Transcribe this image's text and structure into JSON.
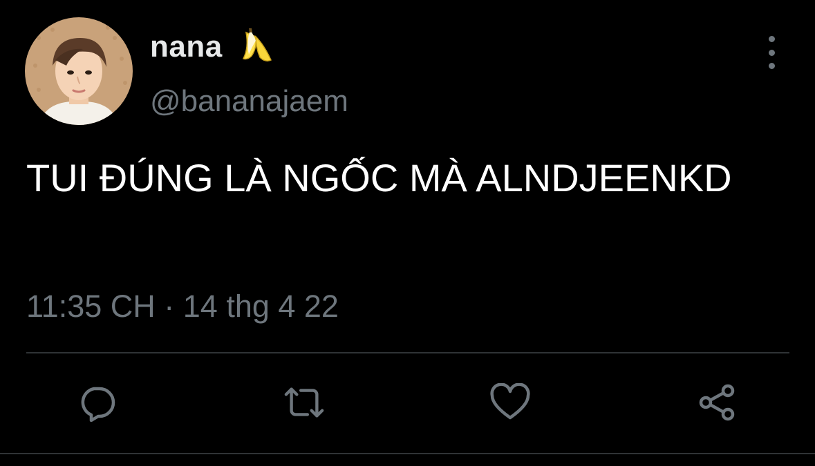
{
  "user": {
    "display_name": "nana",
    "emoji_icon": "banana-icon",
    "handle": "@bananajaem"
  },
  "tweet": {
    "text": "TUI ĐÚNG LÀ NGỐC MÀ ALNDJEENKD",
    "timestamp": "11:35 CH · 14 thg 4 22"
  },
  "actions": [
    {
      "name": "reply",
      "icon": "reply-icon"
    },
    {
      "name": "retweet",
      "icon": "retweet-icon"
    },
    {
      "name": "like",
      "icon": "heart-icon"
    },
    {
      "name": "share",
      "icon": "share-icon"
    }
  ],
  "colors": {
    "background": "#000000",
    "primary_text": "#ffffff",
    "secondary_text": "#6e767d",
    "divider": "#2f3336"
  }
}
